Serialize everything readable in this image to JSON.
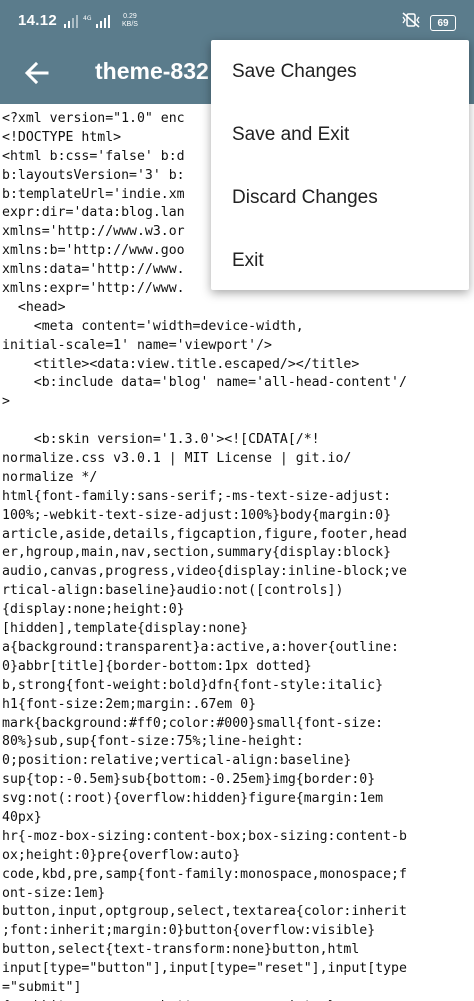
{
  "status_bar": {
    "time": "14.12",
    "network_type": "4G",
    "speed_value": "0.29",
    "speed_unit": "KB/S",
    "battery": "69"
  },
  "app_bar": {
    "title": "theme-832"
  },
  "menu": {
    "items": [
      "Save Changes",
      "Save and Exit",
      "Discard Changes",
      "Exit"
    ]
  },
  "editor": {
    "lines": [
      "<?xml version=\"1.0\" enc",
      "<!DOCTYPE html>",
      "<html b:css='false' b:d",
      "b:layoutsVersion='3' b:",
      "b:templateUrl='indie.xm",
      "expr:dir='data:blog.lan",
      "xmlns='http://www.w3.or",
      "xmlns:b='http://www.goo",
      "xmlns:data='http://www.",
      "xmlns:expr='http://www.",
      "  <head>",
      "    <meta content='width=device-width,",
      "initial-scale=1' name='viewport'/>",
      "    <title><data:view.title.escaped/></title>",
      "    <b:include data='blog' name='all-head-content'/",
      ">",
      "",
      "    <b:skin version='1.3.0'><![CDATA[/*!",
      "normalize.css v3.0.1 | MIT License | git.io/",
      "normalize */",
      "html{font-family:sans-serif;-ms-text-size-adjust:",
      "100%;-webkit-text-size-adjust:100%}body{margin:0}",
      "article,aside,details,figcaption,figure,footer,head",
      "er,hgroup,main,nav,section,summary{display:block}",
      "audio,canvas,progress,video{display:inline-block;ve",
      "rtical-align:baseline}audio:not([controls])",
      "{display:none;height:0}",
      "[hidden],template{display:none}",
      "a{background:transparent}a:active,a:hover{outline:",
      "0}abbr[title]{border-bottom:1px dotted}",
      "b,strong{font-weight:bold}dfn{font-style:italic}",
      "h1{font-size:2em;margin:.67em 0}",
      "mark{background:#ff0;color:#000}small{font-size:",
      "80%}sub,sup{font-size:75%;line-height:",
      "0;position:relative;vertical-align:baseline}",
      "sup{top:-0.5em}sub{bottom:-0.25em}img{border:0}",
      "svg:not(:root){overflow:hidden}figure{margin:1em",
      "40px}",
      "hr{-moz-box-sizing:content-box;box-sizing:content-b",
      "ox;height:0}pre{overflow:auto}",
      "code,kbd,pre,samp{font-family:monospace,monospace;f",
      "ont-size:1em}",
      "button,input,optgroup,select,textarea{color:inherit",
      ";font:inherit;margin:0}button{overflow:visible}",
      "button,select{text-transform:none}button,html",
      "input[type=\"button\"],input[type=\"reset\"],input[type",
      "=\"submit\"]",
      "{-webkit-appearance:button;cursor:pointer}"
    ]
  }
}
